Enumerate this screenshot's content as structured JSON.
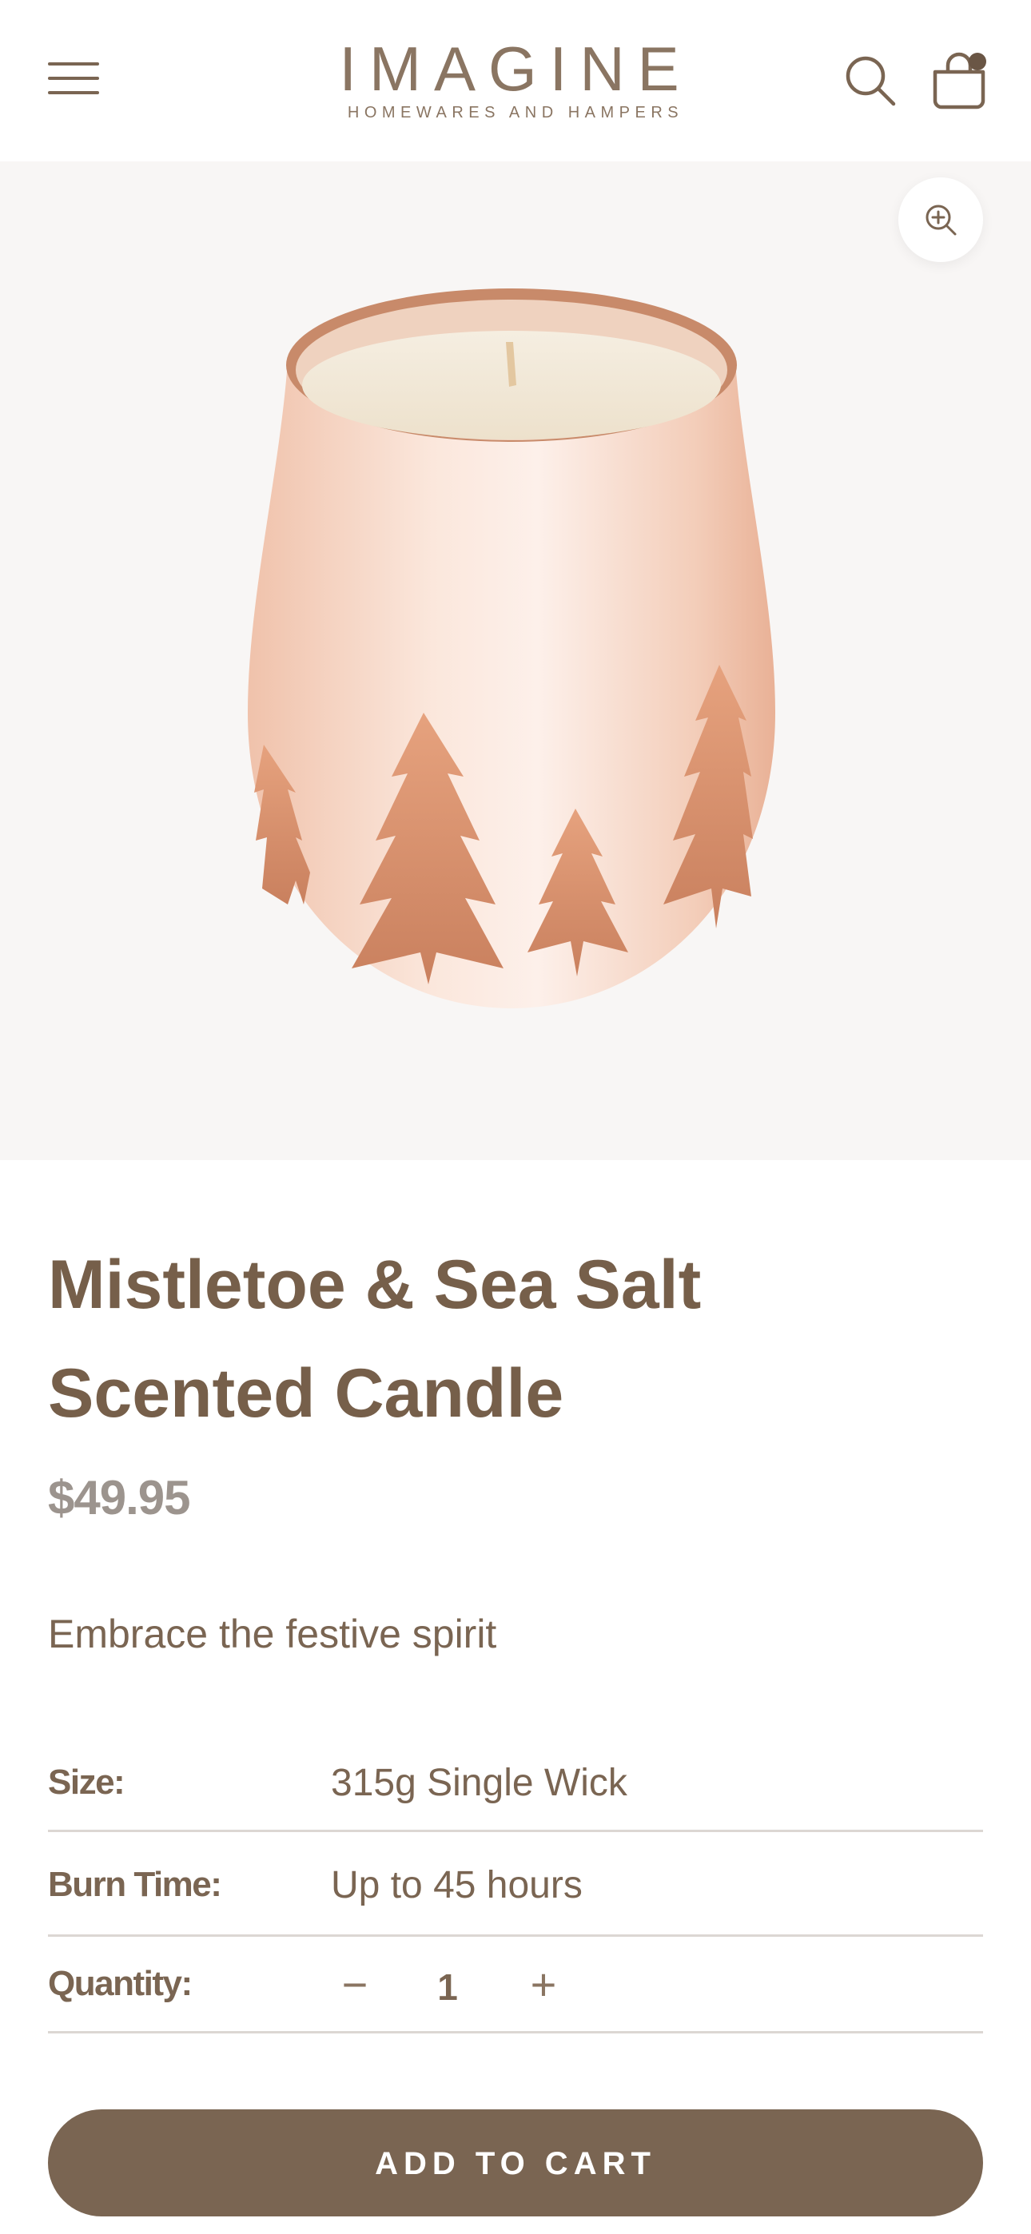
{
  "header": {
    "brand": "IMAGINE",
    "brand_tagline": "HOMEWARES AND HAMPERS",
    "menu_icon": "hamburger-menu-icon",
    "search_icon": "search-icon",
    "cart_icon": "shopping-bag-icon",
    "cart_has_items": true
  },
  "gallery": {
    "image_alt": "Rose gold glass candle with tree silhouettes",
    "zoom_icon": "zoom-in-icon",
    "background": "#f8f6f5"
  },
  "product": {
    "title": "Mistletoe & Sea Salt Scented Candle",
    "price": "$49.95",
    "tagline": "Embrace the festive spirit",
    "specs": {
      "size_label": "Size:",
      "size_value": "315g Single Wick",
      "burn_label": "Burn Time:",
      "burn_value": "Up to 45 hours",
      "qty_label": "Quantity:",
      "qty_minus": "−",
      "qty_value": "1",
      "qty_plus": "+"
    },
    "add_to_cart": "ADD TO CART"
  },
  "colors": {
    "brand_brown": "#7a6552",
    "price_grey": "#9c948e",
    "divider": "#dcd7d3"
  }
}
